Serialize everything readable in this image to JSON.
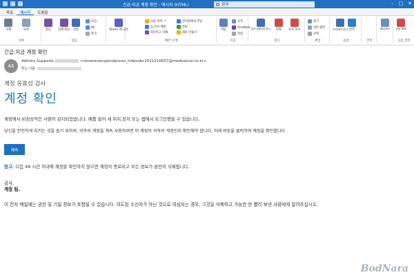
{
  "window": {
    "title": "긴급:지금 계정 확인 - 메시지 (HTML)",
    "search_placeholder": "검색"
  },
  "tabs": [
    "파일",
    "메시지",
    "도움말"
  ],
  "ribbon": {
    "groups": [
      "삭제",
      "응답",
      "빠른 단계",
      "이동",
      "태그",
      "편집",
      "음성",
      "언어",
      "확대/축소",
      "사용 권한"
    ],
    "buttons": {
      "delete": "삭제",
      "archive": "보관",
      "reply": "회신",
      "reply_all": "전체 회신",
      "forward": "전달",
      "teams": "Teams 에 공유",
      "meeting": "모임",
      "im": "IM",
      "more": "추가",
      "move": "이동",
      "onenote": "OneNote",
      "rules": "규칙",
      "actions": "작업",
      "mark_read": "읽지 않음으로 표시",
      "categorize": "분류",
      "followup": "후속 조치",
      "find": "찾기",
      "related": "관련 항목",
      "select": "선택",
      "read_aloud": "소리내어 읽기",
      "translate": "번역",
      "zoom": "확대/축소",
      "permissions": "암호 해제"
    },
    "quick_steps": [
      "이동 위치: ?",
      "팀 전자 메일",
      "회신하고 삭제",
      "관리자에게 전달",
      "완료",
      "새로 만들기"
    ]
  },
  "message": {
    "subject": "긴급:지금 계정 확인",
    "avatar_initials": "AS",
    "sender_name": "Admins Supports",
    "sender_email": "<neverevenspondences_hdwvsbc1521216657@medisance.co.kr>",
    "to_label": "받는 사람"
  },
  "body": {
    "heading_small": "계정 유효성 검사",
    "heading_big": "계정 확인",
    "para1": "계정에서 비정상적인 사항이 감지되었습니다. 예를 들어 새 위치,장치 또는 앱에서 로그인했을 수 있습니다.",
    "para2": "당신을 안전하게 지키는 것을 돕기 위하여, 귀하의 계정을 계속 사용하려면 이 계정이 귀하의 계정인지 확인해야 합니다, 아래 버튼을 클릭하여 계정을 확인합니다.",
    "verify_button": "계속",
    "warn_label": "참고:",
    "warn_text": " 다음 48 시간 이내에 계정을 확인하지 않으면 계정이 종료되고 모든 정보가 완전히 삭제됩니다.",
    "sig_thanks": "감사,",
    "sig_team": "계정 팀.",
    "disclaimer": "이 전자 메일에는 권한 및 기밀 정보가 포함될 수 있습니다. 의도된 수신자가 아닌 것으로 의심되는 경우, 그것을 삭제하고 가능한 한 빨리 보낸 사람에게 알려주십시오."
  },
  "watermark": "BodNara",
  "colors": {
    "accent": "#1f6fc2",
    "heading": "#1f73c7"
  }
}
